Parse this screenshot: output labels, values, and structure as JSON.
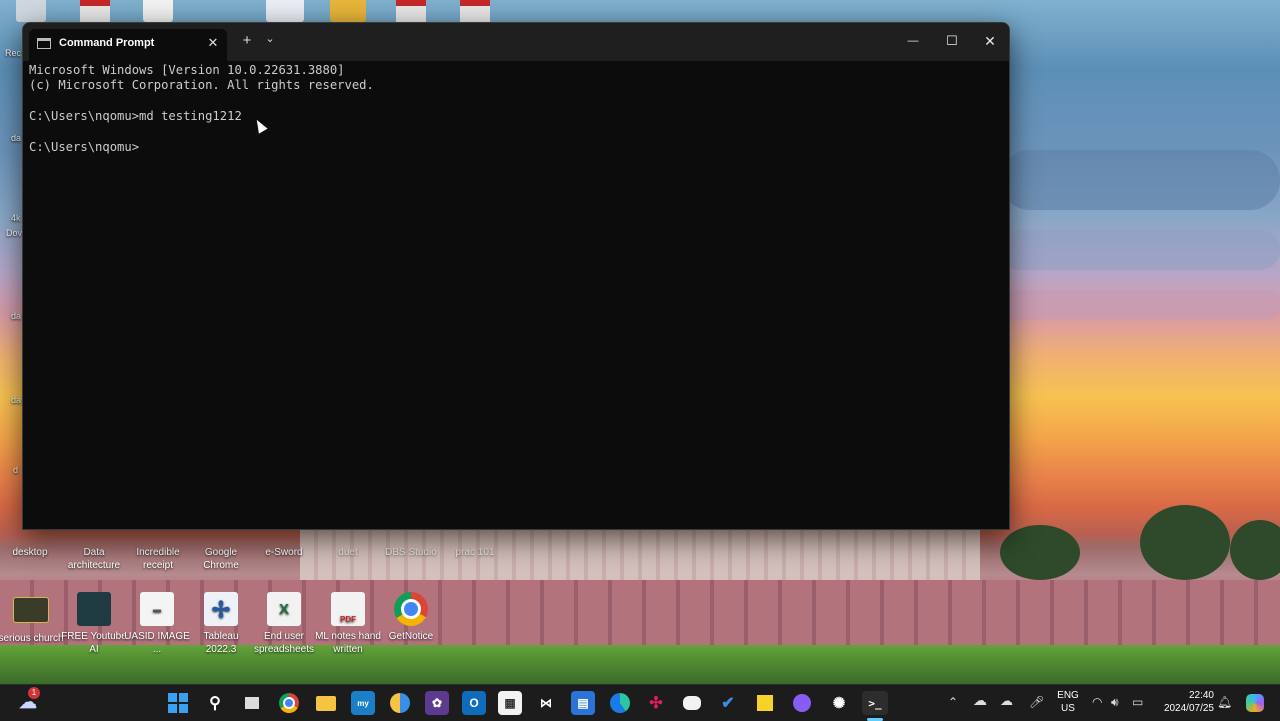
{
  "window": {
    "tab_title": "Command Prompt",
    "tab_close": "✕",
    "new_tab": "+",
    "tab_dropdown": "⌄",
    "minimize": "—",
    "maximize": "☐",
    "close": "✕"
  },
  "console": {
    "lines": [
      "Microsoft Windows [Version 10.0.22631.3880]",
      "(c) Microsoft Corporation. All rights reserved.",
      "",
      "C:\\Users\\nqomu>md testing1212",
      "",
      "C:\\Users\\nqomu>"
    ]
  },
  "desktop": {
    "icons_row1": [
      {
        "label": "desktop"
      },
      {
        "label": "Data architecture"
      },
      {
        "label": "Incredible receipt"
      },
      {
        "label": "Google Chrome"
      },
      {
        "label": "e-Sword"
      },
      {
        "label": "duet"
      },
      {
        "label": "DBS Studio"
      },
      {
        "label": "prac 101"
      }
    ],
    "icons_row2": [
      {
        "label": "serious church"
      },
      {
        "label": "FREE Youtube AI"
      },
      {
        "label": "UASID IMAGE ..."
      },
      {
        "label": "Tableau 2022.3"
      },
      {
        "label": "End user spreadsheets"
      },
      {
        "label": "ML notes hand written"
      },
      {
        "label": "GetNotice"
      }
    ],
    "left_fragments": [
      "Rec",
      "da",
      "4k",
      "Dov",
      "da",
      "da",
      "d"
    ]
  },
  "taskbar": {
    "weather_badge": "1",
    "language_line1": "ENG",
    "language_line2": "US",
    "time": "22:40",
    "date": "2024/07/25",
    "pinned": [
      "start-icon",
      "search-icon",
      "task-view-icon",
      "chrome-icon",
      "file-explorer-icon",
      "mylo-icon",
      "chrome-beta-icon",
      "photo-editor-icon",
      "outlook-icon",
      "store-icon",
      "capcut-icon",
      "calendar-icon",
      "edge-icon",
      "slack-icon",
      "discord-icon",
      "todo-icon",
      "sticky-notes-icon",
      "github-icon",
      "chatgpt-icon",
      "terminal-icon"
    ]
  }
}
